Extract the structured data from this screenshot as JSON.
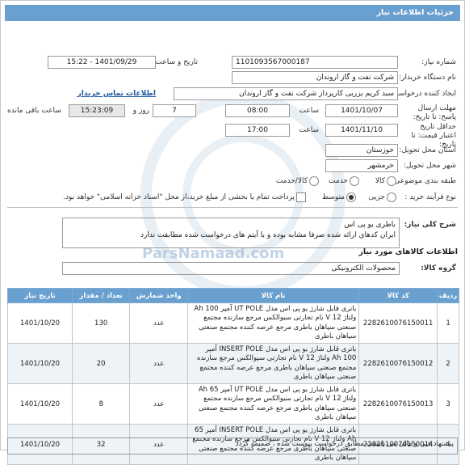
{
  "header": {
    "title": "جزئیات اطلاعات نیاز"
  },
  "fields": {
    "need_number_label": "شماره نیاز:",
    "need_number": "1101093567000187",
    "announce_label": "تاریخ و ساعت اعلان عمومی:",
    "announce_value": "1401/09/29 - 15:22",
    "buyer_org_label": "نام دستگاه خریدار:",
    "buyer_org": "شرکت نفت و گاز اروندان",
    "creator_label": "ایجاد کننده درخواست:",
    "creator": "سید کریم یزربی کارپرداز شرکت نفت و گاز اروندان",
    "contact_link": "اطلاعات تماس خریدار",
    "deadline_label": "مهلت ارسال پاسخ: تا تاریخ:",
    "deadline_date": "1401/10/07",
    "time_label": "ساعت",
    "deadline_time": "08:00",
    "days_value": "7",
    "days_label": "روز و",
    "remaining_time": "15:23:09",
    "remaining_label": "ساعت باقی مانده",
    "validity_label": "حداقل تاریخ اعتبار قیمت: تا تاریخ:",
    "validity_date": "1401/11/10",
    "validity_time_label": "ساعت",
    "validity_time": "17:00",
    "province_label": "استان محل تحویل:",
    "province": "خوزستان",
    "city_label": "شهر محل تحویل:",
    "city": "خرمشهر",
    "category_label": "طبقه بندی موضوعی:",
    "category_options": [
      "کالا",
      "خدمت",
      "کالا/خدمت"
    ],
    "purchase_type_label": "نوع فرآیند خرید :",
    "purchase_type_options": [
      "جزیی",
      "متوسط"
    ],
    "payment_note": "پرداخت تمام یا بخشی از مبلغ خرید،از محل \"اسناد خزانه اسلامی\" خواهد بود."
  },
  "description": {
    "label": "شرح کلی نیاز:",
    "line1": "باطری یو پی اس",
    "line2": "ایران کدهای ارائه شده صرفا مشابه بوده و با آیتم های درخواست شده مطابقت ندارد"
  },
  "goods_section_title": "اطلاعات کالاهای مورد نیاز",
  "group": {
    "label": "گروه کالا:",
    "value": "محصولات الکترونیکی"
  },
  "table": {
    "headers": [
      "ردیف",
      "کد کالا",
      "نام کالا",
      "واحد شمارش",
      "تعداد / مقدار",
      "تاریخ نیاز"
    ],
    "rows": [
      {
        "idx": "1",
        "code": "2282610076150011",
        "name": "باتری قابل شارژ یو پی اس مدل UT POLE آمپر 100 Ah ولتاژ 12 V نام تجارتی سیوالکس مرجع سازنده مجتمع صنعتی سپاهان باطری مرجع عرضه کننده مجتمع صنعتی سپاهان باطری",
        "unit": "عدد",
        "qty": "130",
        "date": "1401/10/20"
      },
      {
        "idx": "2",
        "code": "2282610076150012",
        "name": "باتری قابل شارژ یو پی اس مدل INSERT POLE آمپر 100 Ah ولتاژ 12 V نام تجارتی سیوالکس مرجع سازنده مجتمع صنعتی سپاهان باطری مرجع عرضه کننده مجتمع صنعتی سپاهان باطری",
        "unit": "عدد",
        "qty": "20",
        "date": "1401/10/20"
      },
      {
        "idx": "3",
        "code": "2282610076150013",
        "name": "باتری قابل شارژ یو پی اس مدل UT POLE آمپر 65 Ah ولتاژ 12 V نام تجارتی سیوالکس مرجع سازنده مجتمع صنعتی سپاهان باطری مرجع عرضه کننده مجتمع صنعتی سپاهان باطری",
        "unit": "عدد",
        "qty": "8",
        "date": "1401/10/20"
      },
      {
        "idx": "4",
        "code": "2282610076150014",
        "name": "باتری قابل شارژ یو پی اس مدل INSERT POLE آمپر 65 Ah ولتاژ 12 V نام تجارتی سیوالکس مرجع سازنده مجتمع صنعتی سپاهان باطری مرجع عرضه کننده مجتمع صنعتی سپاهان باطری",
        "unit": "عدد",
        "qty": "32",
        "date": "1401/10/20"
      }
    ]
  },
  "suggestion": "پیشنهاد فنی و مالی می بایست مطابق درخواست پیوست شده ، ضمیمه گردد",
  "watermark_text": "ParsNamaad.com"
}
